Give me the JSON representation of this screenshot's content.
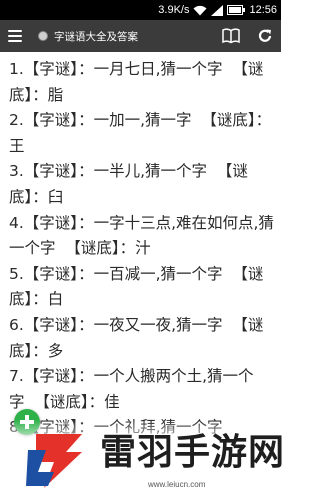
{
  "status_bar": {
    "network_speed": "3.9K/s",
    "time": "12:56"
  },
  "app_bar": {
    "title": "字谜语大全及答案",
    "icons": [
      "menu-icon",
      "globe-icon",
      "book-icon",
      "refresh-icon"
    ]
  },
  "riddles": [
    {
      "num": "1.",
      "tag_q": "【字谜】",
      "question": "：一月七日,猜一个字",
      "tag_a": "【谜底】",
      "answer": "：脂"
    },
    {
      "num": "2.",
      "tag_q": "【字谜】",
      "question": "：一加一,猜一字",
      "tag_a": "【谜底】",
      "answer": "：王"
    },
    {
      "num": "3.",
      "tag_q": "【字谜】",
      "question": "：一半儿,猜一个字",
      "tag_a": "【谜底】",
      "answer": "：臼"
    },
    {
      "num": "4.",
      "tag_q": "【字谜】",
      "question": "：一字十三点,难在如何点,猜一个字",
      "tag_a": "【谜底】",
      "answer": "：汁"
    },
    {
      "num": "5.",
      "tag_q": "【字谜】",
      "question": "：一百减一,猜一个字",
      "tag_a": "【谜底】",
      "answer": "：白"
    },
    {
      "num": "6.",
      "tag_q": "【字谜】",
      "question": "：一夜又一夜,猜一字",
      "tag_a": "【谜底】",
      "answer": "：多"
    },
    {
      "num": "7.",
      "tag_q": "【字谜】",
      "question": "：一个人搬两个土,猜一个字",
      "tag_a": "【谜底】",
      "answer": "：佳"
    },
    {
      "num": "8.",
      "tag_q": "【字谜】",
      "question": "：一个礼拜,猜一个字",
      "tag_a": "",
      "answer": ""
    }
  ],
  "fab": {
    "icon": "plus-icon"
  },
  "watermark": {
    "text": "雷羽手游网",
    "url": "www.leiucn.com",
    "colors": {
      "red": "#e4322b",
      "blue": "#1d4fa3"
    }
  },
  "colors": {
    "status_bar": "#000000",
    "app_bar": "#3b3b3b",
    "text": "#2a2a2a",
    "fab": "#2fb14a"
  }
}
